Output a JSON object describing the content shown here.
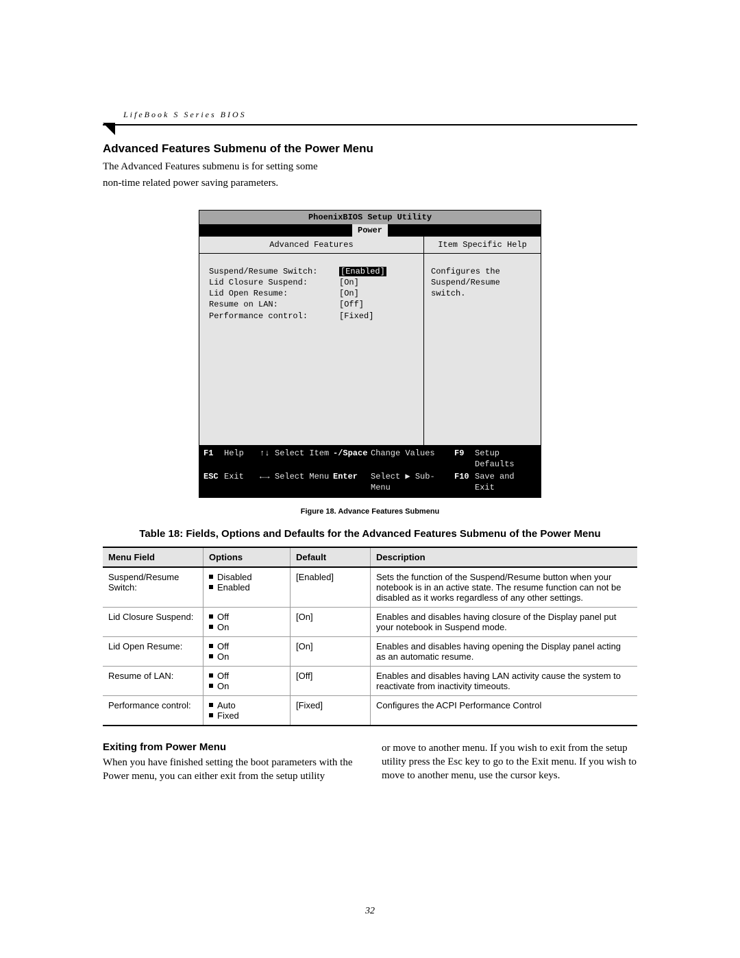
{
  "header": {
    "running": "LifeBook S Series BIOS"
  },
  "section": {
    "heading": "Advanced Features Submenu of the Power Menu",
    "intro1": "The Advanced Features submenu is for setting some",
    "intro2": "non-time related power saving parameters."
  },
  "bios": {
    "title": "PhoenixBIOS Setup Utility",
    "tab": "Power",
    "left_title": "Advanced Features",
    "right_title": "Item Specific Help",
    "help1": "Configures the",
    "help2": "Suspend/Resume switch.",
    "rows": [
      {
        "label": "Suspend/Resume Switch:",
        "value": "Enabled",
        "selected": true
      },
      {
        "label": "Lid Closure Suspend:",
        "value": "[On]"
      },
      {
        "label": "Lid Open Resume:",
        "value": "[On]"
      },
      {
        "label": "Resume on LAN:",
        "value": "[Off]"
      },
      {
        "label": "Performance control:",
        "value": "[Fixed]"
      }
    ],
    "footer": {
      "r1": {
        "k1": "F1",
        "v1": "Help",
        "arr1": "↑↓",
        "v2": "Select Item",
        "k2": "-/Space",
        "v3": "Change Values",
        "k3": "F9",
        "v4": "Setup Defaults"
      },
      "r2": {
        "k1": "ESC",
        "v1": "Exit",
        "arr1": "←→",
        "v2": "Select Menu",
        "k2": "Enter",
        "v3": "Select ▶ Sub-Menu",
        "k3": "F10",
        "v4": "Save and Exit"
      }
    }
  },
  "figure_caption": "Figure 18.  Advance Features Submenu",
  "table": {
    "title": "Table 18: Fields, Options and Defaults for the Advanced Features Submenu of the Power Menu",
    "headers": {
      "c1": "Menu Field",
      "c2": "Options",
      "c3": "Default",
      "c4": "Description"
    },
    "rows": [
      {
        "field": "Suspend/Resume Switch:",
        "options": [
          "Disabled",
          "Enabled"
        ],
        "def": "[Enabled]",
        "desc": "Sets the function of the Suspend/Resume button when your notebook is in an active state. The resume function can not be disabled as it works regardless of any other settings."
      },
      {
        "field": "Lid Closure Suspend:",
        "options": [
          "Off",
          "On"
        ],
        "def": "[On]",
        "desc": "Enables and disables having closure of the Display panel put your notebook in Suspend mode."
      },
      {
        "field": "Lid Open Resume:",
        "options": [
          "Off",
          "On"
        ],
        "def": "[On]",
        "desc": "Enables and disables having opening the Display panel acting as an automatic resume."
      },
      {
        "field": "Resume of LAN:",
        "options": [
          "Off",
          "On"
        ],
        "def": "[Off]",
        "desc": "Enables and disables having LAN activity cause the system to reactivate from inactivity timeouts."
      },
      {
        "field": "Performance control:",
        "options": [
          "Auto",
          "Fixed"
        ],
        "def": "[Fixed]",
        "desc": "Configures the ACPI Performance Control"
      }
    ]
  },
  "exiting": {
    "heading": "Exiting from Power Menu",
    "left": "When you have finished setting the boot parameters with the Power menu, you can either exit from the setup utility",
    "right": "or move to another menu. If you wish to exit from the setup utility press the Esc key to go to the Exit menu. If you wish to move to another menu, use the cursor keys."
  },
  "page_number": "32"
}
